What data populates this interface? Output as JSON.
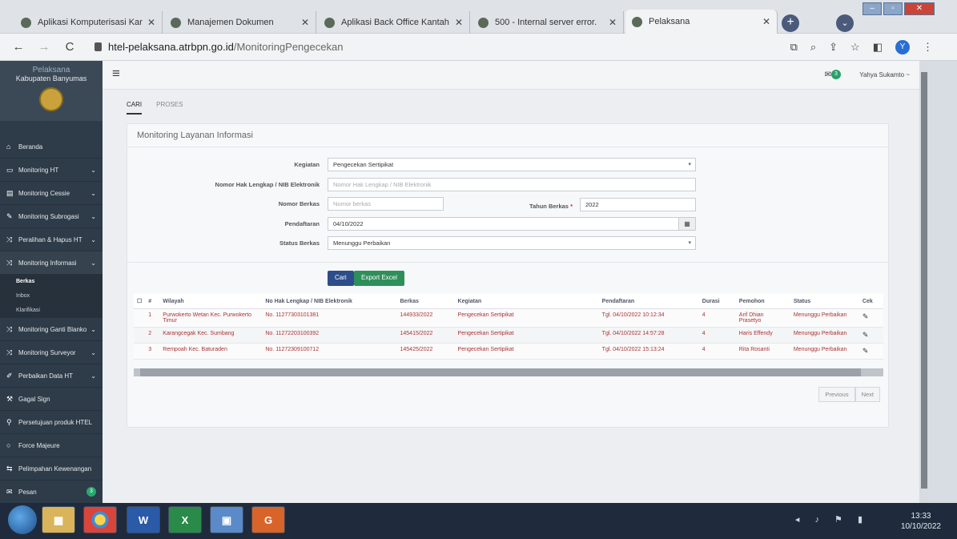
{
  "browser": {
    "tabs": [
      {
        "title": "Aplikasi Komputerisasi Kantor",
        "active": false
      },
      {
        "title": "Manajemen Dokumen",
        "active": false
      },
      {
        "title": "Aplikasi Back Office Kantah",
        "active": false
      },
      {
        "title": "500 - Internal server error.",
        "active": false
      },
      {
        "title": "Pelaksana",
        "active": true
      }
    ],
    "url_domain": "htel-pelaksana.atrbpn.go.id",
    "url_path": "/MonitoringPengecekan",
    "profile_initial": "Y"
  },
  "sidebar": {
    "app_name": "Pelaksana",
    "office": "Kabupaten Banyumas",
    "items": [
      {
        "label": "Beranda",
        "icon": "home-icon",
        "chevron": false
      },
      {
        "label": "Monitoring HT",
        "icon": "card-icon",
        "chevron": true
      },
      {
        "label": "Monitoring Cessie",
        "icon": "doc-icon",
        "chevron": true
      },
      {
        "label": "Monitoring Subrogasi",
        "icon": "edit-icon",
        "chevron": true
      },
      {
        "label": "Peralihan & Hapus HT",
        "icon": "shuffle-icon",
        "chevron": true
      },
      {
        "label": "Monitoring Informasi",
        "icon": "shuffle-icon",
        "chevron": true,
        "open": true
      }
    ],
    "submenu": [
      "Berkas",
      "Inbox",
      "Klarifikasi"
    ],
    "items_after": [
      {
        "label": "Monitoring Ganti Blanko",
        "icon": "shuffle-icon",
        "chevron": true
      },
      {
        "label": "Monitoring Surveyor",
        "icon": "shuffle-icon",
        "chevron": true
      },
      {
        "label": "Perbaikan Data HT",
        "icon": "pencil-icon",
        "chevron": true
      },
      {
        "label": "Gagal Sign",
        "icon": "wrench-icon",
        "chevron": false
      },
      {
        "label": "Persetujuan produk HTEL",
        "icon": "sitemap-icon",
        "chevron": false
      },
      {
        "label": "Force Majeure",
        "icon": "circle-icon",
        "chevron": false
      },
      {
        "label": "Pelimpahan Kewenangan",
        "icon": "transfer-icon",
        "chevron": false
      },
      {
        "label": "Pesan",
        "icon": "mail-icon",
        "chevron": false,
        "badge": "3"
      }
    ]
  },
  "topbar": {
    "mail_badge": "3",
    "user_name": "Yahya Sukamto ~"
  },
  "page": {
    "tabs": [
      "CARI",
      "PROSES"
    ],
    "active_tab": "CARI",
    "panel_title": "Monitoring Layanan Informasi",
    "form": {
      "kegiatan_label": "Kegiatan",
      "kegiatan_value": "Pengecekan Sertipikat",
      "nomor_hak_label": "Nomor Hak Lengkap / NIB Elektronik",
      "nomor_hak_placeholder": "Nomor Hak Lengkap / NIB Elektronik",
      "nomor_berkas_label": "Nomor Berkas",
      "nomor_berkas_placeholder": "Nomor berkas",
      "tahun_label": "Tahun Berkas",
      "tahun_value": "2022",
      "pendaftaran_label": "Pendaftaran",
      "pendaftaran_value": "04/10/2022",
      "status_label": "Status Berkas",
      "status_value": "Menunggu Perbaikan"
    },
    "buttons": {
      "cari": "Cari",
      "export": "Export Excel"
    },
    "table": {
      "headers": [
        "#",
        "Wilayah",
        "No Hak Lengkap / NIB Elektronik",
        "Berkas",
        "Kegiatan",
        "Pendaftaran",
        "Durasi",
        "Pemohon",
        "Status",
        "Cek"
      ],
      "rows": [
        {
          "no": "1",
          "wilayah": "Purwokerto Wetan Kec. Purwokerto Timur",
          "nohak": "No. 11277303101381",
          "berkas": "144933/2022",
          "kegiatan": "Pengecekan Sertipikat",
          "pendaftaran": "Tgl. 04/10/2022 10:12:34",
          "durasi": "4",
          "pemohon": "Arif Dhian Prasetyo",
          "status": "Menunggu Perbaikan"
        },
        {
          "no": "2",
          "wilayah": "Karangcegak Kec. Sumbang",
          "nohak": "No. 11272203100392",
          "berkas": "145415/2022",
          "kegiatan": "Pengecekan Sertipikat",
          "pendaftaran": "Tgl. 04/10/2022 14:57:28",
          "durasi": "4",
          "pemohon": "Haris Effendy",
          "status": "Menunggu Perbaikan"
        },
        {
          "no": "3",
          "wilayah": "Rempoah Kec. Baturaden",
          "nohak": "No. 11272309100712",
          "berkas": "145425/2022",
          "kegiatan": "Pengecekan Sertipikat",
          "pendaftaran": "Tgl. 04/10/2022 15:13:24",
          "durasi": "4",
          "pemohon": "Rita Rosanti",
          "status": "Menunggu Perbaikan"
        }
      ]
    },
    "pager": {
      "previous": "Previous",
      "next": "Next"
    }
  },
  "taskbar": {
    "time": "13:33",
    "date": "10/10/2022"
  }
}
